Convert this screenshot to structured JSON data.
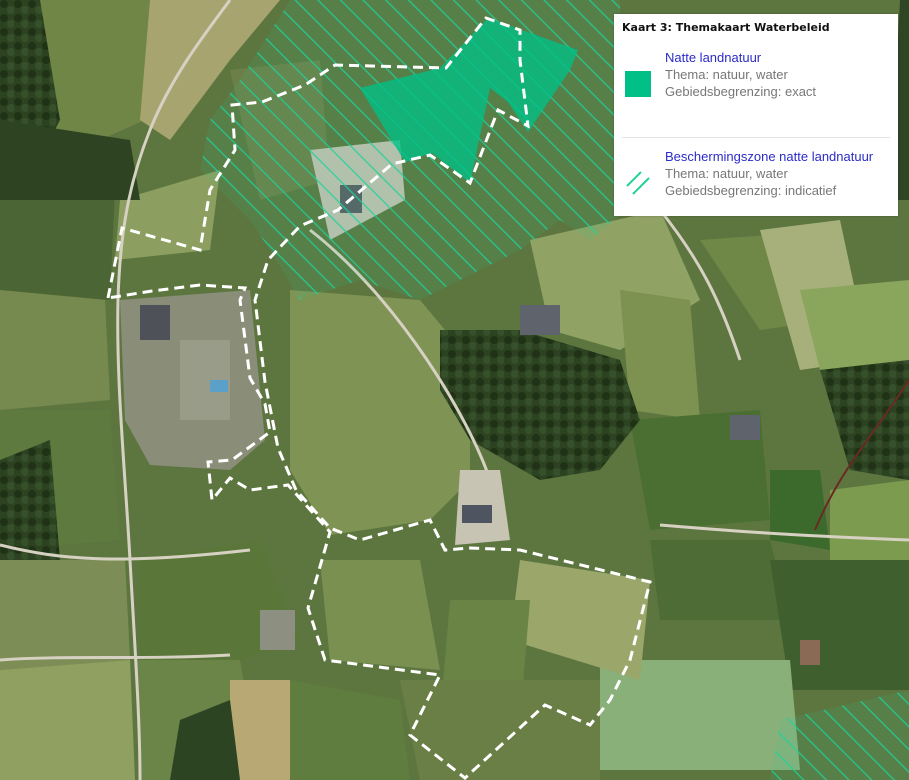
{
  "legend": {
    "title": "Kaart 3: Themakaart Waterbeleid",
    "items": [
      {
        "name": "Natte landnatuur",
        "thema": "Thema: natuur, water",
        "begrenzing": "Gebiedsbegrenzing: exact",
        "symbol": "solid-fill",
        "color": "#00c087"
      },
      {
        "name": "Beschermingszone natte landnatuur",
        "thema": "Thema: natuur, water",
        "begrenzing": "Gebiedsbegrenzing: indicatief",
        "symbol": "diagonal-hatch",
        "color": "#1fd29a"
      }
    ]
  },
  "map": {
    "type": "aerial-photo",
    "boundary_line": "white dashed",
    "colors": {
      "field_dark": "#4f6636",
      "field_light": "#8fa464",
      "forest": "#263a1c",
      "road": "#d9d4c6",
      "boundary": "#ffffff"
    }
  }
}
